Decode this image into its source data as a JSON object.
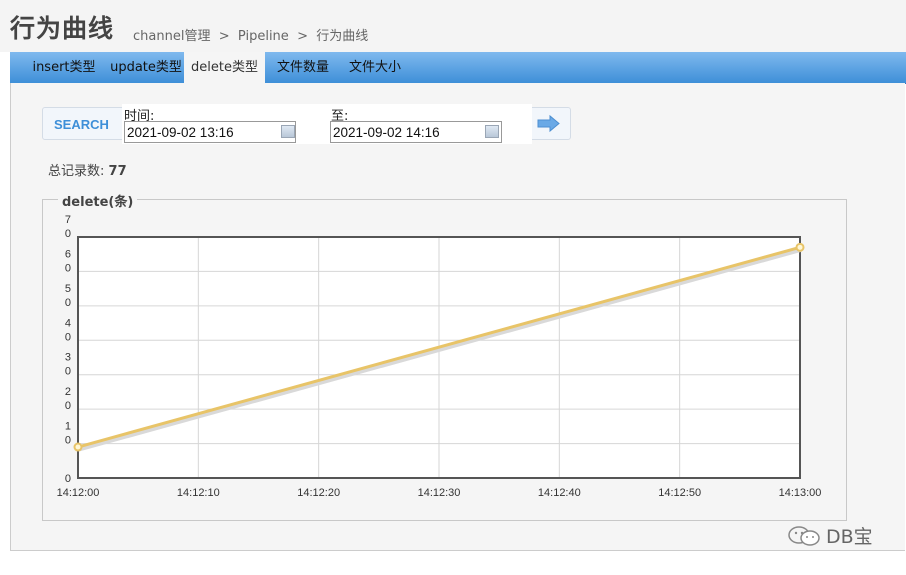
{
  "header": {
    "title": "行为曲线",
    "breadcrumb": [
      "channel管理",
      ">",
      "Pipeline",
      ">",
      "行为曲线"
    ]
  },
  "tabs": [
    {
      "label": "insert类型",
      "active": false
    },
    {
      "label": "update类型",
      "active": false
    },
    {
      "label": "delete类型",
      "active": true
    },
    {
      "label": "文件数量",
      "active": false
    },
    {
      "label": "文件大小",
      "active": false
    }
  ],
  "search": {
    "button_label": "SEARCH",
    "start_label": "时间:",
    "start_value": "2021-09-02 13:16",
    "end_label": "至:",
    "end_value": "2021-09-02 14:16"
  },
  "summary": {
    "label": "总记录数:",
    "value": "77"
  },
  "chart_panel": {
    "legend": "delete(条)"
  },
  "chart_data": {
    "type": "line",
    "x": [
      "14:12:00",
      "14:13:00"
    ],
    "xticks": [
      "14:12:00",
      "14:12:10",
      "14:12:20",
      "14:12:30",
      "14:12:40",
      "14:12:50",
      "14:13:00"
    ],
    "yticks": [
      "0",
      "1\n0",
      "2\n0",
      "3\n0",
      "4\n0",
      "5\n0",
      "6\n0",
      "7\n0"
    ],
    "ylim": [
      0,
      70
    ],
    "series": [
      {
        "values": [
          9,
          67
        ],
        "color": "#e8c468"
      }
    ],
    "grid": true
  },
  "watermark": {
    "text": "DB宝"
  },
  "colors": {
    "tab_gradient_top": "#7fb9ee",
    "tab_gradient_bottom": "#3e8fd8",
    "accent": "#3e8fd8",
    "line": "#e8c468"
  }
}
